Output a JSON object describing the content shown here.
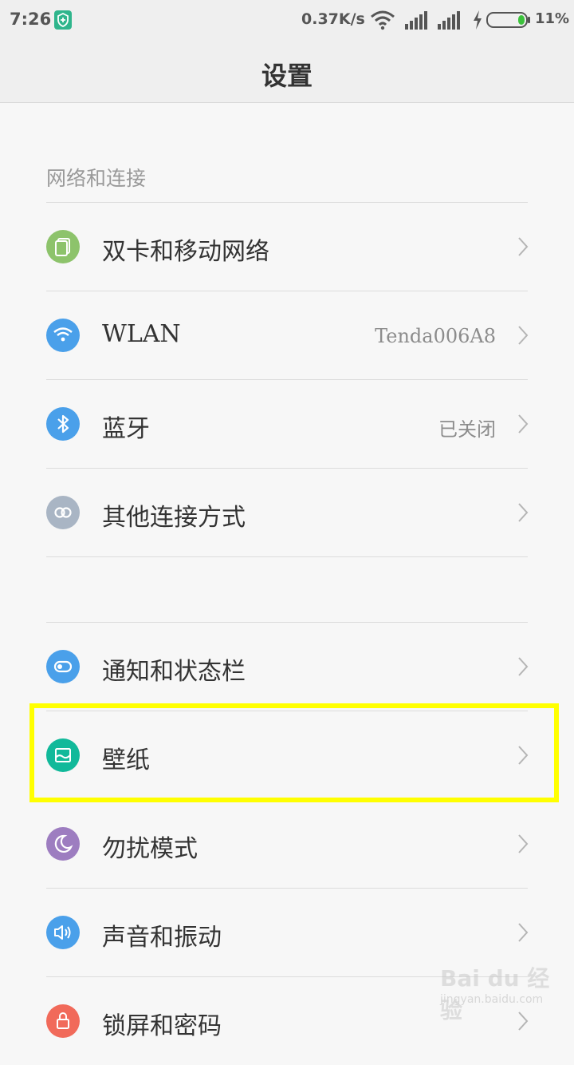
{
  "status_bar": {
    "time": "7:26",
    "net_speed": "0.37K/s",
    "battery_pct": "11%",
    "battery_level": 0.11
  },
  "header": {
    "title": "设置"
  },
  "sections": {
    "network_title": "网络和连接"
  },
  "rows": {
    "sim": {
      "label": "双卡和移动网络",
      "icon": "sim-card-icon",
      "color": "#8dc36b"
    },
    "wlan": {
      "label": "WLAN",
      "value": "Tenda006A8",
      "icon": "wifi-icon",
      "color": "#4aa0ea"
    },
    "bluetooth": {
      "label": "蓝牙",
      "value": "已关闭",
      "icon": "bluetooth-icon",
      "color": "#4aa0ea"
    },
    "other": {
      "label": "其他连接方式",
      "icon": "link-icon",
      "color": "#a9b5c4"
    },
    "notify": {
      "label": "通知和状态栏",
      "icon": "toggle-icon",
      "color": "#4aa0ea"
    },
    "wallpaper": {
      "label": "壁纸",
      "icon": "wallpaper-icon",
      "color": "#11b99a"
    },
    "dnd": {
      "label": "勿扰模式",
      "icon": "moon-icon",
      "color": "#9d7dc0"
    },
    "sound": {
      "label": "声音和振动",
      "icon": "speaker-icon",
      "color": "#4aa0ea"
    },
    "lock": {
      "label": "锁屏和密码",
      "icon": "lock-icon",
      "color": "#f16a5a"
    }
  },
  "watermark": {
    "logo": "Bai du 经验",
    "sub": "jingyan.baidu.com"
  },
  "highlight_color": "#ffff00"
}
